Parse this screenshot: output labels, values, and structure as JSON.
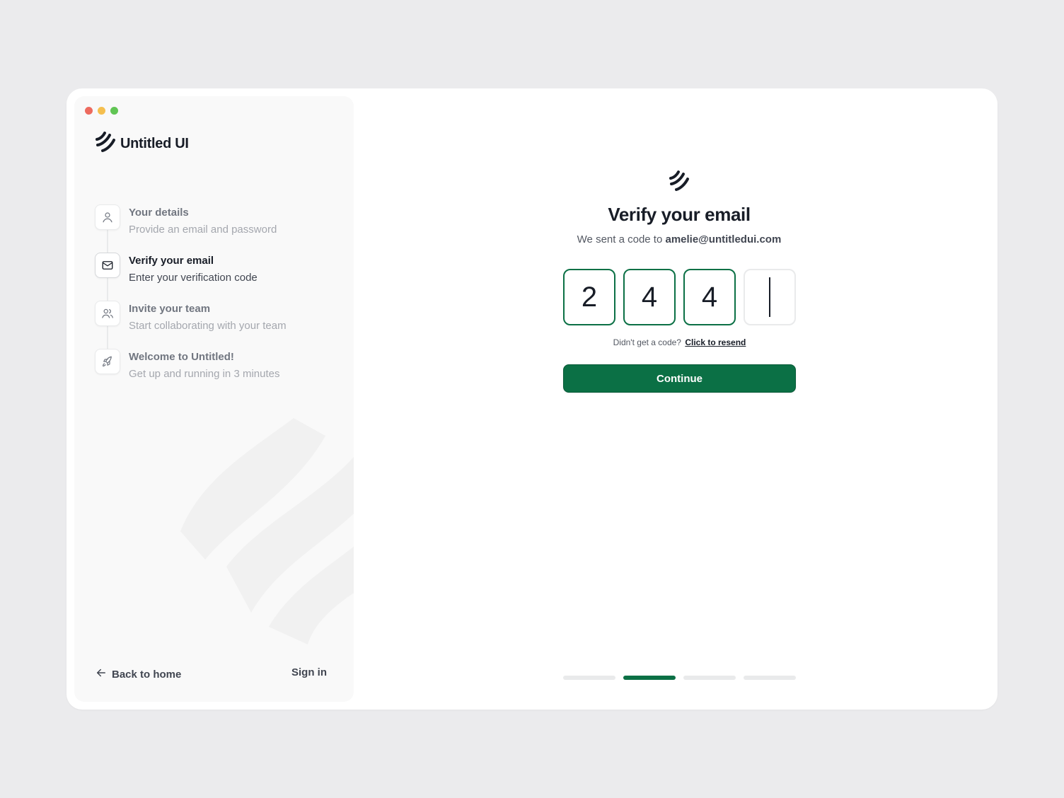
{
  "brand": {
    "name": "Untitled UI"
  },
  "steps": [
    {
      "title": "Your details",
      "description": "Provide an email and password",
      "icon": "user-icon",
      "active": false
    },
    {
      "title": "Verify your email",
      "description": "Enter your verification code",
      "icon": "mail-icon",
      "active": true
    },
    {
      "title": "Invite your team",
      "description": "Start collaborating with your team",
      "icon": "users-icon",
      "active": false
    },
    {
      "title": "Welcome to Untitled!",
      "description": "Get up and running in 3 minutes",
      "icon": "rocket-icon",
      "active": false
    }
  ],
  "footer": {
    "back_label": "Back to home",
    "signin_label": "Sign in"
  },
  "verify": {
    "title": "Verify your email",
    "subtitle_prefix": "We sent a code to",
    "email": "amelie@untitledui.com",
    "code_digits": [
      "2",
      "4",
      "4",
      ""
    ],
    "resend_prefix": "Didn't get a code?",
    "resend_link": "Click to resend",
    "continue_label": "Continue"
  },
  "progress": {
    "total_steps": 4,
    "current_step": 2
  },
  "colors": {
    "accent": "#0b7045",
    "border": "#e9eaeb",
    "sidebar_bg": "#f9f9f9",
    "page_bg": "#ebebed"
  }
}
